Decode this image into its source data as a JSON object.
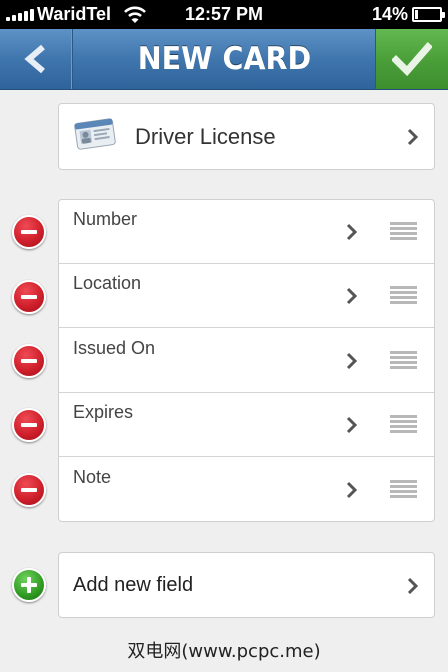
{
  "status_bar": {
    "carrier": "WaridTel",
    "time": "12:57 PM",
    "battery_percent": "14%",
    "battery_level": 0.14,
    "signal_bars": 5
  },
  "nav_bar": {
    "title": "NEW CARD",
    "back_icon": "chevron-left-icon",
    "done_icon": "checkmark-icon",
    "colors": {
      "nav": "#3f76ad",
      "done": "#4ba03a"
    }
  },
  "card_type": {
    "label": "Driver License",
    "icon": "driver-license-icon"
  },
  "fields": [
    {
      "label": "Number"
    },
    {
      "label": "Location"
    },
    {
      "label": "Issued On"
    },
    {
      "label": "Expires"
    },
    {
      "label": "Note"
    }
  ],
  "add_field": {
    "label": "Add new field"
  },
  "watermark": "双电网(www.pcpc.me)"
}
